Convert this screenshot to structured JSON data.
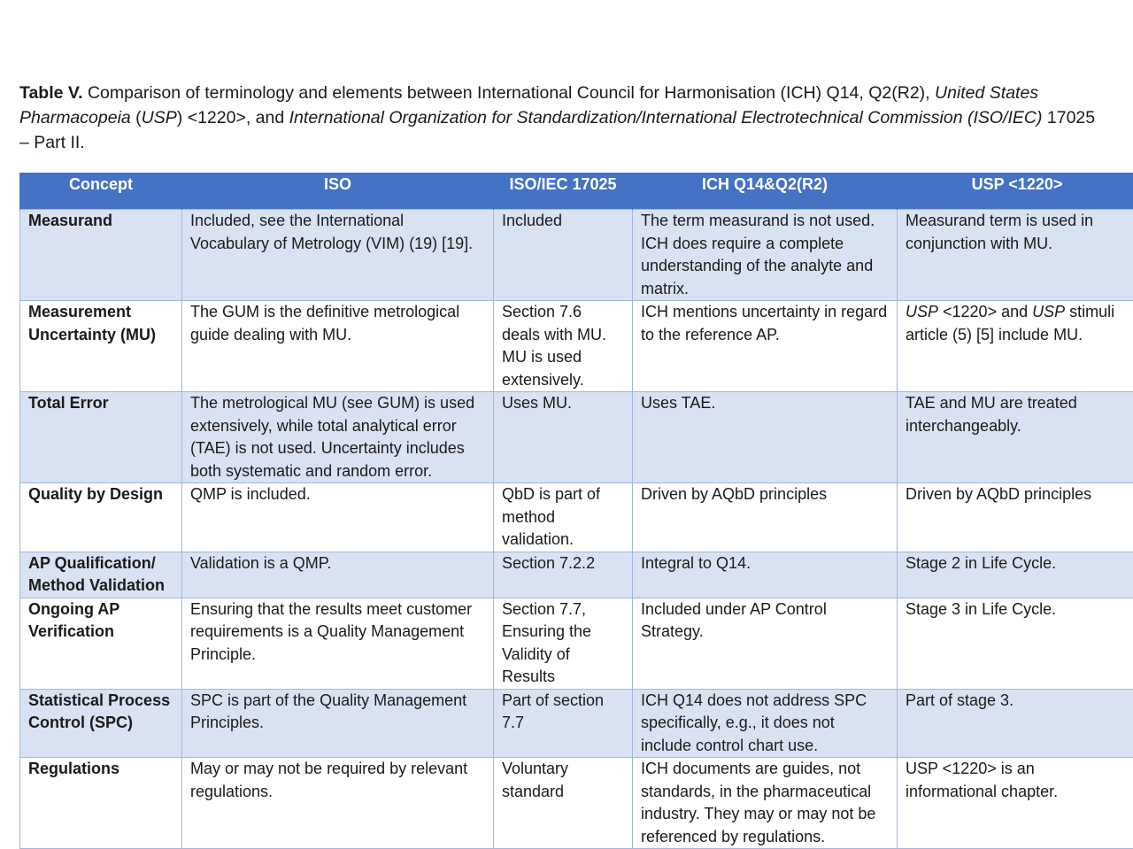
{
  "caption": {
    "label": "Table V.",
    "parts": [
      {
        "text": " Comparison of terminology and elements between International Council for Harmonisation (ICH) Q14, Q2(R2), ",
        "italic": false
      },
      {
        "text": "United States Pharmacopeia",
        "italic": true
      },
      {
        "text": " (",
        "italic": false
      },
      {
        "text": "USP",
        "italic": true
      },
      {
        "text": ") <1220>, and ",
        "italic": false
      },
      {
        "text": "International Organization for Standardization/International Electrotechnical Commission (ISO/IEC)",
        "italic": true
      },
      {
        "text": " 17025 – Part II.",
        "italic": false
      }
    ]
  },
  "table": {
    "headers": [
      "Concept",
      "ISO",
      "ISO/IEC 17025",
      "ICH Q14&Q2(R2)",
      "USP <1220>"
    ],
    "colors": {
      "header_bg": "#4472c4",
      "shaded_row_bg": "#d9e2f3",
      "border": "#9fb6df"
    },
    "rows": [
      {
        "concept": "Measurand",
        "iso": "Included, see the International Vocabulary of Metrology (VIM) (19) [19].",
        "iso17025": "Included",
        "ich": "The term measurand is not used. ICH does require a complete understanding of the analyte and matrix.",
        "usp": "Measurand term is used in conjunction with MU."
      },
      {
        "concept": "Measurement Uncertainty (MU)",
        "iso": "The GUM is the definitive metrological guide dealing with MU.",
        "iso17025": "Section 7.6 deals with MU. MU is used extensively.",
        "ich": "ICH mentions uncertainty in regard to the reference AP.",
        "usp": "USP <1220> and USP stimuli article (5) [5] include MU."
      },
      {
        "concept": "Total Error",
        "iso": "The metrological MU (see GUM) is used extensively, while total analytical error (TAE) is not used. Uncertainty includes both systematic and random error.",
        "iso17025": "Uses MU.",
        "ich": "Uses TAE.",
        "usp": "TAE and MU are treated interchangeably."
      },
      {
        "concept": "Quality by Design",
        "iso": "QMP is included.",
        "iso17025": "QbD is part of method validation.",
        "ich": "Driven by AQbD principles",
        "usp": "Driven by AQbD principles"
      },
      {
        "concept": "AP Qualification/ Method Validation",
        "iso": "Validation is a QMP.",
        "iso17025": "Section 7.2.2",
        "ich": "Integral to Q14.",
        "usp": "Stage 2 in Life Cycle."
      },
      {
        "concept": "Ongoing AP Verification",
        "iso": "Ensuring that the results meet customer requirements is a Quality Management Principle.",
        "iso17025": "Section 7.7, Ensuring the Validity of Results",
        "ich": "Included under AP Control Strategy.",
        "usp": "Stage 3 in Life Cycle."
      },
      {
        "concept": "Statistical Process Control (SPC)",
        "iso": "SPC is part of the Quality Management Principles.",
        "iso17025": "Part of section 7.7",
        "ich": "ICH Q14 does not address SPC specifically, e.g., it does not include control chart use.",
        "usp": "Part of stage 3."
      },
      {
        "concept": "Regulations",
        "iso": "May or may not be required by relevant regulations.",
        "iso17025": "Voluntary standard",
        "ich": "ICH documents are guides, not standards, in the pharmaceutical industry. They may or may not be referenced by regulations.",
        "usp": "USP <1220> is an informational chapter."
      }
    ]
  }
}
